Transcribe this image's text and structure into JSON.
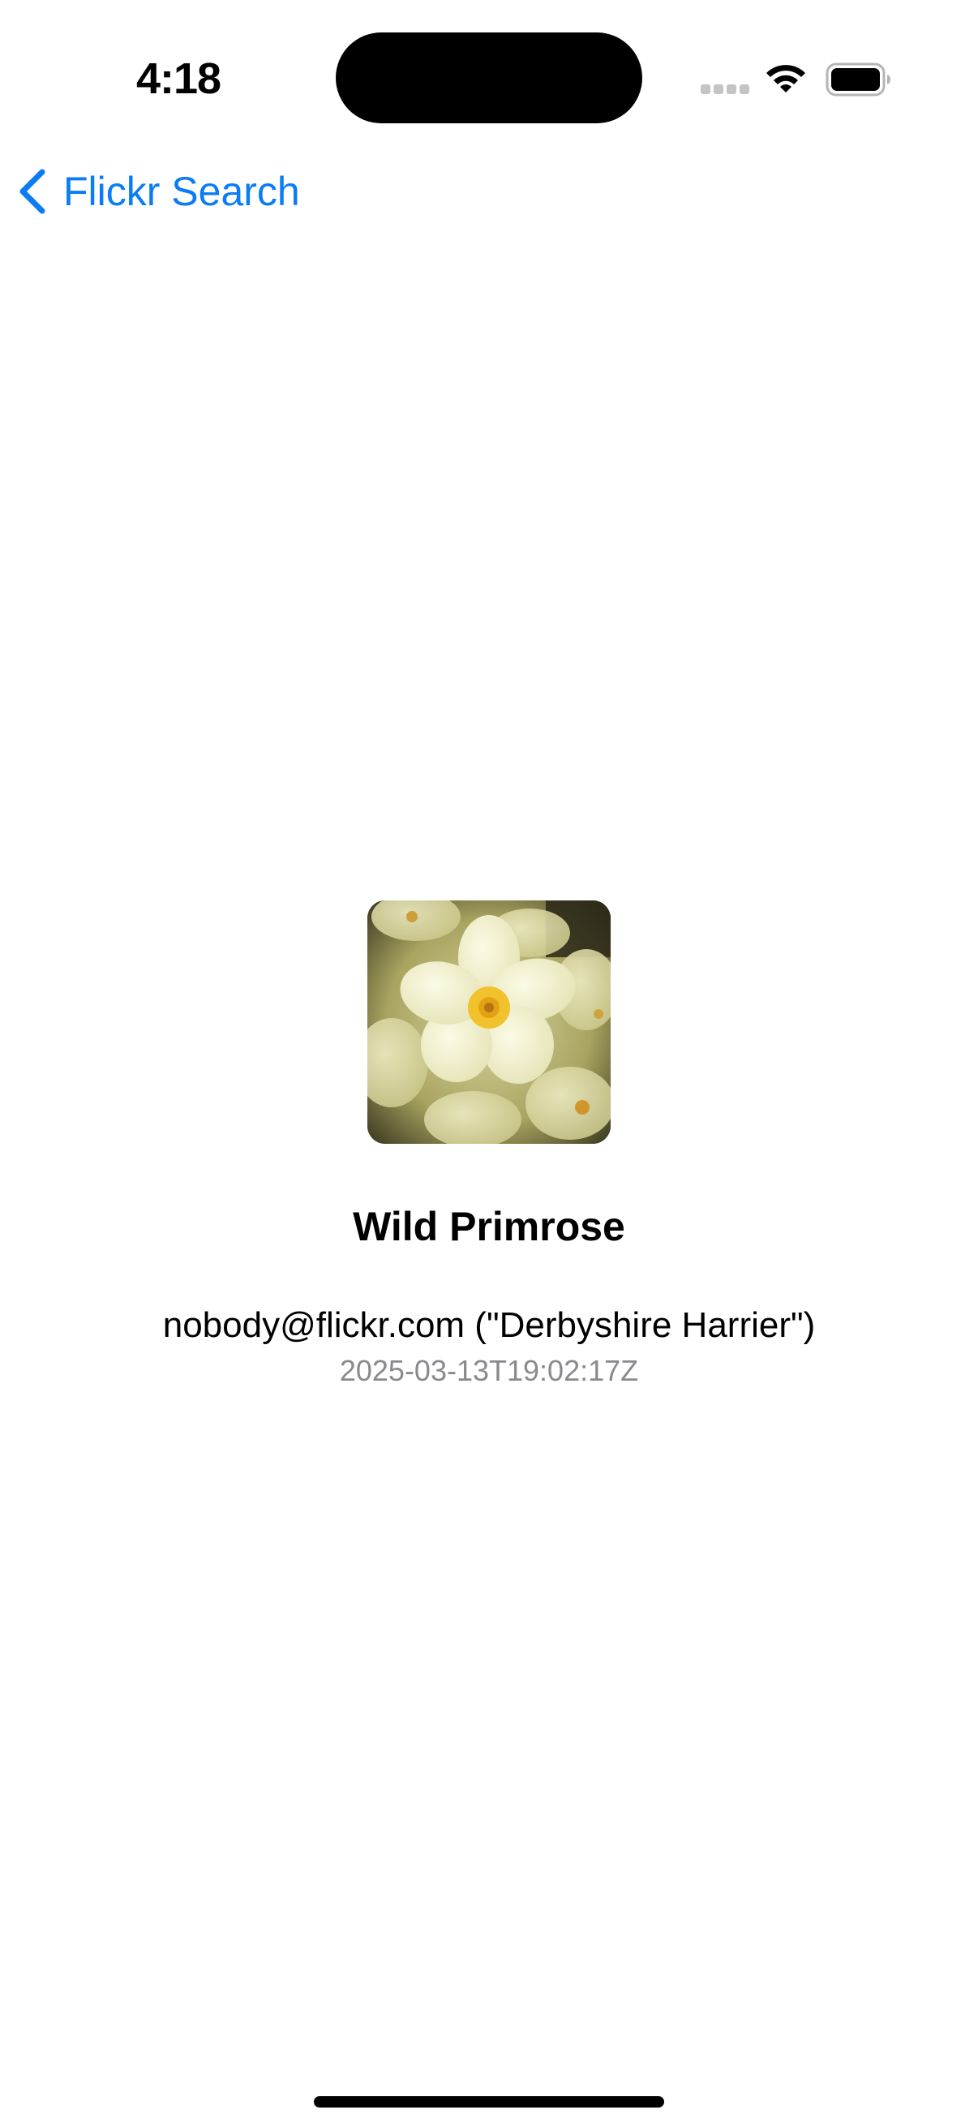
{
  "status_bar": {
    "time": "4:18",
    "icons": [
      "cell-signal-icon",
      "wifi-icon",
      "battery-icon"
    ]
  },
  "nav": {
    "back_label": "Flickr Search",
    "back_icon": "chevron-left-icon"
  },
  "photo": {
    "image_icon": "primrose-photo",
    "title": "Wild Primrose",
    "author": "nobody@flickr.com (\"Derbyshire Harrier\")",
    "date_taken": "2025-03-13T19:02:17Z"
  },
  "colors": {
    "accent": "#0a7cf5",
    "primary_text": "#000000",
    "secondary_text": "#8a8a8e",
    "background": "#ffffff"
  }
}
